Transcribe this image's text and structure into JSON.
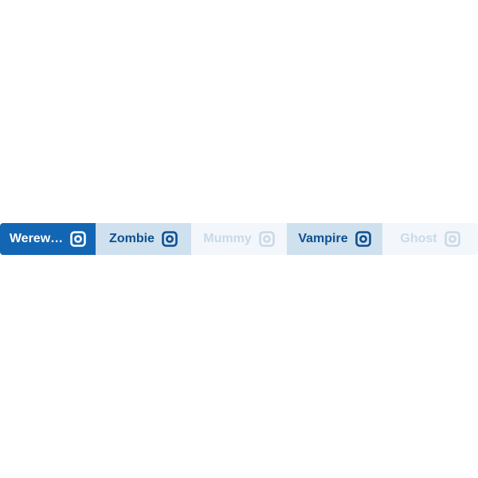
{
  "tabs": [
    {
      "label": "Werew…",
      "icon": "instagram-icon",
      "state": "selected"
    },
    {
      "label": "Zombie",
      "icon": "instagram-icon",
      "state": "active"
    },
    {
      "label": "Mummy",
      "icon": "instagram-icon",
      "state": "disabled"
    },
    {
      "label": "Vampire",
      "icon": "instagram-icon",
      "state": "active"
    },
    {
      "label": "Ghost",
      "icon": "instagram-icon",
      "state": "disabled"
    }
  ],
  "colors": {
    "selected_bg": "#1366b3",
    "active_bg": "#cfe0ef",
    "active_text": "#0d4f8f",
    "disabled_bg": "#f3f7fb",
    "disabled_text": "#c9d9e8"
  }
}
